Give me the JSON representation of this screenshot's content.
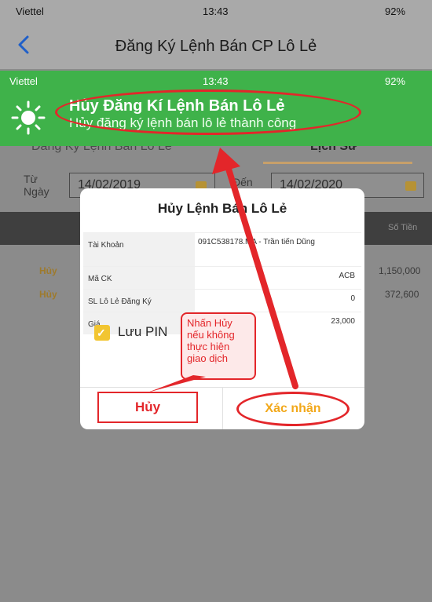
{
  "status_bar": {
    "carrier": "Viettel",
    "time": "13:43",
    "battery": "92%"
  },
  "nav": {
    "title": "Đăng Ký Lệnh Bán CP Lô Lẻ",
    "back_icon": "chevron-left-icon"
  },
  "notification": {
    "status": {
      "carrier": "Viettel",
      "time": "13:43",
      "battery": "92%"
    },
    "title": "Hủy Đăng Kí Lệnh Bán Lô Lẻ",
    "message": "Hủy đăng ký lệnh bán lô lẻ thành công",
    "icon": "sun-icon",
    "bg_color": "#3fb24a"
  },
  "tabs": [
    {
      "label": "Đăng Ký Lệnh Bán Lô Lẻ"
    },
    {
      "label": "Lịch Sử"
    }
  ],
  "filter": {
    "from_label": "Từ Ngày",
    "from_date": "14/02/2019",
    "to_label": "Đến",
    "to_date": "14/02/2020"
  },
  "table": {
    "sum_label": "Số Tiền",
    "rows": [
      {
        "action": "Hủy",
        "amount": "1,150,000"
      },
      {
        "action": "Hủy",
        "amount": "372,600"
      }
    ]
  },
  "modal": {
    "title": "Hủy Lệnh Bán Lô Lẻ",
    "rows": [
      {
        "label": "Tài Khoản",
        "value": "091C538178.MA - Trần tiến Dũng"
      },
      {
        "label": "Mã CK",
        "value": "ACB"
      },
      {
        "label": "SL Lô Lẻ Đăng Ký",
        "value": "0"
      },
      {
        "label": "Giá",
        "value": "23,000"
      }
    ],
    "save_pin_label": "Lưu PIN",
    "cancel_label": "Hủy",
    "confirm_label": "Xác nhận"
  },
  "annotation": {
    "callout_text": "Nhấn Hủy nếu không thực hiện giao dịch",
    "accent": "#e3262a"
  }
}
